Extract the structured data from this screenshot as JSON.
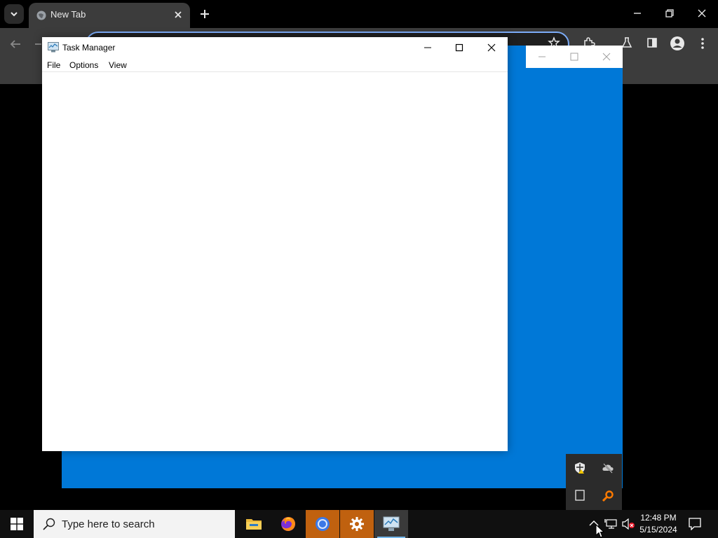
{
  "browser": {
    "tab_title": "New Tab"
  },
  "task_manager": {
    "title": "Task Manager",
    "menu": [
      "File",
      "Options",
      "View"
    ]
  },
  "taskbar": {
    "search_placeholder": "Type here to search",
    "apps": [
      "file-explorer",
      "firefox",
      "chrome",
      "settings",
      "task-manager"
    ],
    "clock_time": "12:48 PM",
    "clock_date": "5/15/2024"
  },
  "colors": {
    "blue_window": "#0078d7",
    "taskbar": "#101010",
    "chrome_toolbar": "#3c3c3c",
    "running_app": "#c0610f"
  },
  "icons": {
    "tray_flyout": [
      "defender-icon",
      "onedrive-offline-icon",
      "tablet-icon",
      "search-magnifier-icon"
    ],
    "system_tray": [
      "show-hidden-icons-chevron",
      "network-icon",
      "volume-muted-icon",
      "action-center-icon"
    ]
  }
}
